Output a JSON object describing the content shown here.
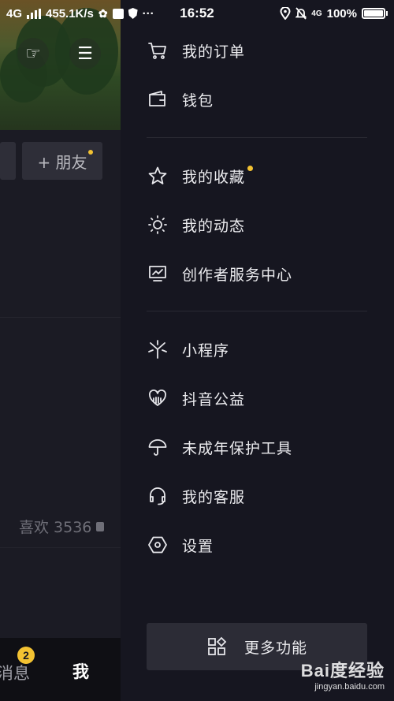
{
  "status_bar": {
    "network": "4G",
    "speed": "455.1K/s",
    "time": "16:52",
    "network2": "4G",
    "battery": "100%"
  },
  "background": {
    "add_friend_label": "+ 朋友",
    "likes_text": "喜欢 3536",
    "messages_badge": "2",
    "messages_tab": "消息",
    "me_tab": "我"
  },
  "drawer": {
    "group1": [
      {
        "label": "我的订单",
        "icon": "cart-icon"
      },
      {
        "label": "钱包",
        "icon": "wallet-icon"
      }
    ],
    "group2": [
      {
        "label": "我的收藏",
        "icon": "star-icon",
        "dot": true
      },
      {
        "label": "我的动态",
        "icon": "sun-icon"
      },
      {
        "label": "创作者服务中心",
        "icon": "monitor-chart-icon"
      }
    ],
    "group3": [
      {
        "label": "小程序",
        "icon": "mini-program-icon"
      },
      {
        "label": "抖音公益",
        "icon": "heart-charity-icon"
      },
      {
        "label": "未成年保护工具",
        "icon": "umbrella-icon"
      },
      {
        "label": "我的客服",
        "icon": "headset-icon"
      },
      {
        "label": "设置",
        "icon": "hexagon-settings-icon"
      }
    ],
    "more_button": "更多功能"
  },
  "watermark": {
    "logo": "Bai度经验",
    "url": "jingyan.baidu.com"
  },
  "colors": {
    "background": "#161620",
    "accent_dot": "#f3c232",
    "button_bg": "#2c2c36"
  }
}
